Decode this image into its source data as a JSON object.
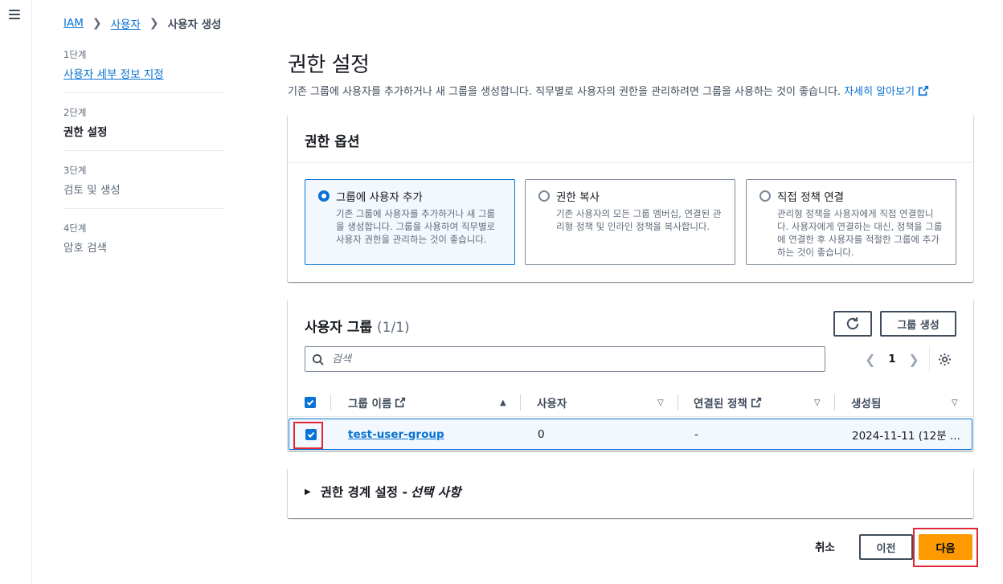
{
  "breadcrumb": {
    "iam": "IAM",
    "users": "사용자",
    "current": "사용자 생성"
  },
  "steps": [
    {
      "num": "1단계",
      "label": "사용자 세부 정보 지정",
      "state": "link"
    },
    {
      "num": "2단계",
      "label": "권한 설정",
      "state": "current"
    },
    {
      "num": "3단계",
      "label": "검토 및 생성",
      "state": "pending"
    },
    {
      "num": "4단계",
      "label": "암호 검색",
      "state": "pending"
    }
  ],
  "page": {
    "title": "권한 설정",
    "description": "기존 그룹에 사용자를 추가하거나 새 그룹을 생성합니다. 직무별로 사용자의 권한을 관리하려면 그룹을 사용하는 것이 좋습니다.",
    "learn_more": "자세히 알아보기"
  },
  "permission_options": {
    "title": "권한 옵션",
    "tiles": [
      {
        "title": "그룹에 사용자 추가",
        "desc": "기존 그룹에 사용자를 추가하거나 새 그룹을 생성합니다. 그룹을 사용하여 직무별로 사용자 권한을 관리하는 것이 좋습니다.",
        "selected": true
      },
      {
        "title": "권한 복사",
        "desc": "기존 사용자의 모든 그룹 멤버십, 연결된 관리형 정책 및 인라인 정책을 복사합니다.",
        "selected": false
      },
      {
        "title": "직접 정책 연결",
        "desc": "관리형 정책을 사용자에게 직접 연결합니다. 사용자에게 연결하는 대신, 정책을 그룹에 연결한 후 사용자를 적절한 그룹에 추가하는 것이 좋습니다.",
        "selected": false
      }
    ]
  },
  "user_groups": {
    "title": "사용자 그룹",
    "count": "(1/1)",
    "create_button": "그룹 생성",
    "search_placeholder": "검색",
    "current_page": "1",
    "columns": {
      "name": "그룹 이름",
      "users": "사용자",
      "policies": "연결된 정책",
      "created": "생성됨"
    },
    "rows": [
      {
        "name": "test-user-group",
        "users": "0",
        "policies": "-",
        "created": "2024-11-11 (12분 ..."
      }
    ]
  },
  "boundary": {
    "label": "권한 경계 설정 - ",
    "suffix": "선택 사항"
  },
  "footer": {
    "cancel": "취소",
    "previous": "이전",
    "next": "다음"
  },
  "colors": {
    "link": "#0972d3",
    "primary_button": "#ff9900",
    "highlight": "#e32636"
  }
}
